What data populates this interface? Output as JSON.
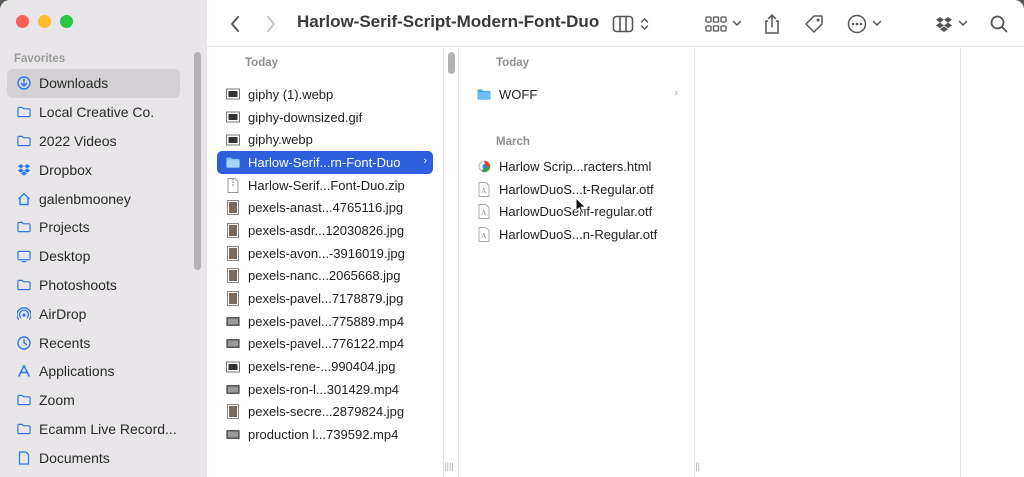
{
  "window": {
    "title": "Harlow-Serif-Script-Modern-Font-Duo"
  },
  "sidebar": {
    "heading": "Favorites",
    "items": [
      {
        "label": "Downloads",
        "icon": "download-icon",
        "active": true
      },
      {
        "label": "Local Creative Co.",
        "icon": "folder-icon"
      },
      {
        "label": "2022 Videos",
        "icon": "folder-icon"
      },
      {
        "label": "Dropbox",
        "icon": "dropbox-icon"
      },
      {
        "label": "galenbmooney",
        "icon": "home-icon"
      },
      {
        "label": "Projects",
        "icon": "folder-icon"
      },
      {
        "label": "Desktop",
        "icon": "desktop-icon"
      },
      {
        "label": "Photoshoots",
        "icon": "folder-icon"
      },
      {
        "label": "AirDrop",
        "icon": "airdrop-icon"
      },
      {
        "label": "Recents",
        "icon": "clock-icon"
      },
      {
        "label": "Applications",
        "icon": "applications-icon"
      },
      {
        "label": "Zoom",
        "icon": "folder-icon"
      },
      {
        "label": "Ecamm Live Record...",
        "icon": "folder-icon"
      },
      {
        "label": "Documents",
        "icon": "document-icon"
      }
    ]
  },
  "column1": {
    "section": "Today",
    "items": [
      {
        "name": "giphy (1).webp",
        "type": "image"
      },
      {
        "name": "giphy-downsized.gif",
        "type": "image"
      },
      {
        "name": "giphy.webp",
        "type": "image"
      },
      {
        "name": "Harlow-Serif...rn-Font-Duo",
        "type": "folder",
        "selected": true
      },
      {
        "name": "Harlow-Serif...Font-Duo.zip",
        "type": "zip"
      },
      {
        "name": "pexels-anast...4765116.jpg",
        "type": "photo"
      },
      {
        "name": "pexels-asdr...12030826.jpg",
        "type": "photo"
      },
      {
        "name": "pexels-avon...-3916019.jpg",
        "type": "photo"
      },
      {
        "name": "pexels-nanc...2065668.jpg",
        "type": "photo"
      },
      {
        "name": "pexels-pavel...7178879.jpg",
        "type": "photo"
      },
      {
        "name": "pexels-pavel...775889.mp4",
        "type": "video"
      },
      {
        "name": "pexels-pavel...776122.mp4",
        "type": "video"
      },
      {
        "name": "pexels-rene-...990404.jpg",
        "type": "image"
      },
      {
        "name": "pexels-ron-l...301429.mp4",
        "type": "video"
      },
      {
        "name": "pexels-secre...2879824.jpg",
        "type": "photo"
      },
      {
        "name": "production l...739592.mp4",
        "type": "video"
      }
    ]
  },
  "column2": {
    "today_section": "Today",
    "today_items": [
      {
        "name": "WOFF",
        "type": "folder"
      }
    ],
    "march_section": "March",
    "march_items": [
      {
        "name": "Harlow Scrip...racters.html",
        "type": "html"
      },
      {
        "name": "HarlowDuoS...t-Regular.otf",
        "type": "font"
      },
      {
        "name": "HarlowDuoSerif-regular.otf",
        "type": "font"
      },
      {
        "name": "HarlowDuoS...n-Regular.otf",
        "type": "font"
      }
    ]
  },
  "colors": {
    "accent": "#2c5fdc",
    "folder": "#4aa8e8",
    "sidebar_icon": "#2f7ae5"
  }
}
